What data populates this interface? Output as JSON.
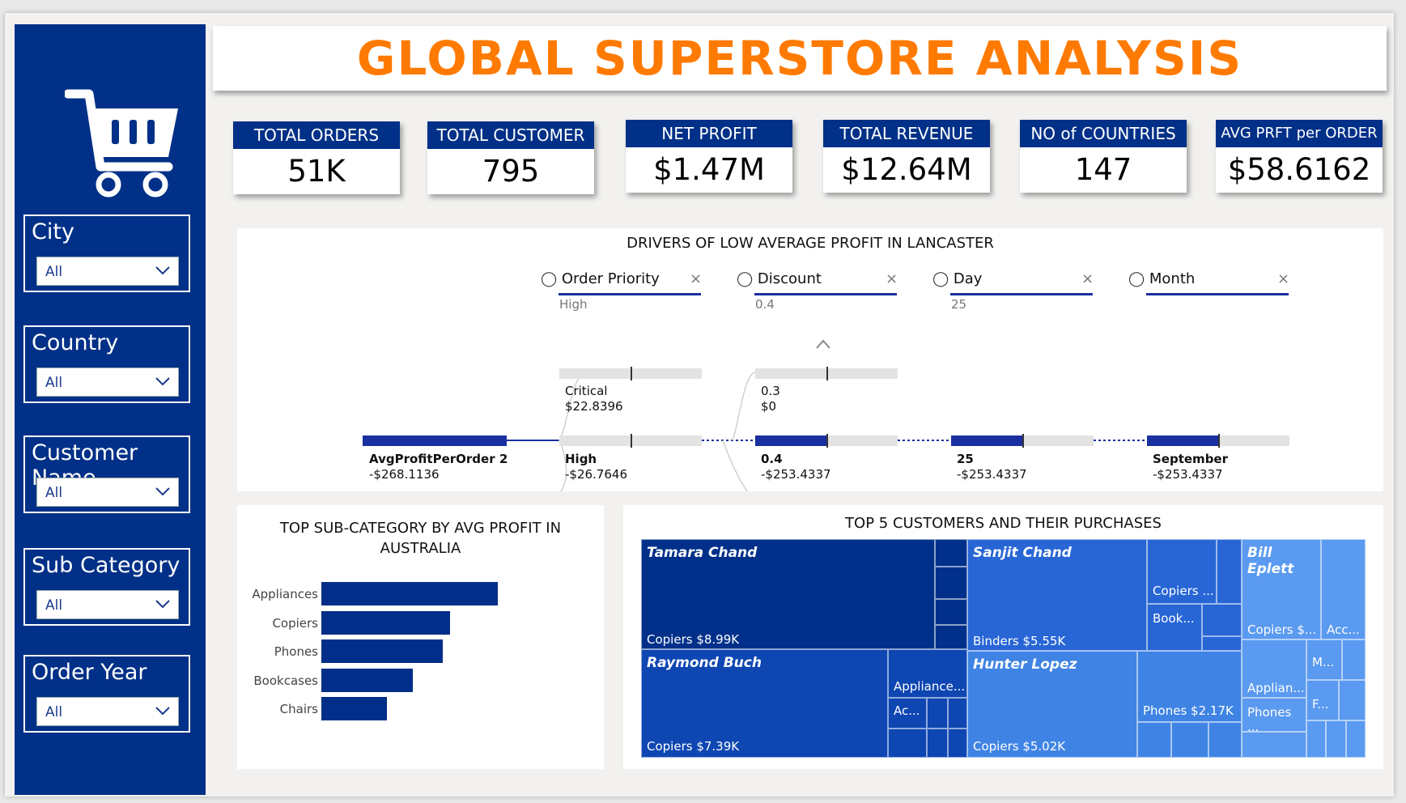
{
  "title": "GLOBAL SUPERSTORE ANALYSIS",
  "filters": [
    {
      "label": "City",
      "value": "All"
    },
    {
      "label": "Country",
      "value": "All"
    },
    {
      "label": "Customer Name",
      "value": "All"
    },
    {
      "label": "Sub Category",
      "value": "All"
    },
    {
      "label": "Order Year",
      "value": "All"
    }
  ],
  "kpis": [
    {
      "label": "TOTAL ORDERS",
      "value": "51K"
    },
    {
      "label": "TOTAL CUSTOMER",
      "value": "795"
    },
    {
      "label": "NET PROFIT",
      "value": "$1.47M"
    },
    {
      "label": "TOTAL REVENUE",
      "value": "$12.64M"
    },
    {
      "label": "NO of COUNTRIES",
      "value": "147"
    },
    {
      "label": "AVG PRFT per ORDER",
      "value": "$58.6162"
    }
  ],
  "decomposition": {
    "title": "DRIVERS OF LOW AVERAGE PROFIT IN LANCASTER",
    "levels": [
      {
        "name": "Order Priority",
        "selected": "High"
      },
      {
        "name": "Discount",
        "selected": "0.4"
      },
      {
        "name": "Day",
        "selected": "25"
      },
      {
        "name": "Month",
        "selected": ""
      }
    ],
    "root": {
      "label": "AvgProfitPerOrder 2",
      "value": "-$268.1136"
    },
    "nodes": [
      {
        "label": "Critical",
        "value": "$22.8396"
      },
      {
        "label": "High",
        "value": "-$26.7646"
      },
      {
        "label": "0.3",
        "value": "$0"
      },
      {
        "label": "0.4",
        "value": "-$253.4337"
      },
      {
        "label": "25",
        "value": "-$253.4337"
      },
      {
        "label": "September",
        "value": "-$253.4337"
      }
    ]
  },
  "subcat": {
    "title_line1": "TOP SUB-CATEGORY BY AVG PROFIT IN",
    "title_line2": "AUSTRALIA"
  },
  "treemap": {
    "title": "TOP 5 CUSTOMERS AND THEIR PURCHASES",
    "customers": [
      {
        "name": "Tamara Chand",
        "top_label": "Copiers $8.99K",
        "color": "#00308a"
      },
      {
        "name": "Sanjit Chand",
        "top_label": "Binders $5.55K",
        "extra": [
          "Copiers ...",
          "Book..."
        ],
        "color": "#2866d6"
      },
      {
        "name": "Bill Eplett",
        "top_label": "Copiers $...",
        "extra": [
          "Acc..."
        ],
        "color": "#5a9af0"
      },
      {
        "name": "Raymond Buch",
        "top_label": "Copiers $7.39K",
        "extra": [
          "Appliance...",
          "Ac..."
        ],
        "color": "#0e46b2"
      },
      {
        "name": "Hunter Lopez",
        "top_label": "Copiers $5.02K",
        "extra": [
          "Phones $2.17K"
        ],
        "color": "#3f84e4"
      },
      {
        "name": "",
        "top_label": "",
        "extra": [
          "Applian...",
          "Phones ...",
          "M...",
          "F..."
        ],
        "color": "#5a9af0"
      }
    ]
  },
  "chart_data": {
    "type": "bar",
    "orientation": "horizontal",
    "title": "TOP SUB-CATEGORY BY AVG PROFIT IN AUSTRALIA",
    "categories": [
      "Appliances",
      "Copiers",
      "Phones",
      "Bookcases",
      "Chairs"
    ],
    "values": [
      100,
      73,
      69,
      52,
      37
    ],
    "xlabel": "",
    "ylabel": "",
    "grid": false
  },
  "colors": {
    "navy": "#003087",
    "orange": "#ff7a00",
    "bar": "#012e88"
  }
}
